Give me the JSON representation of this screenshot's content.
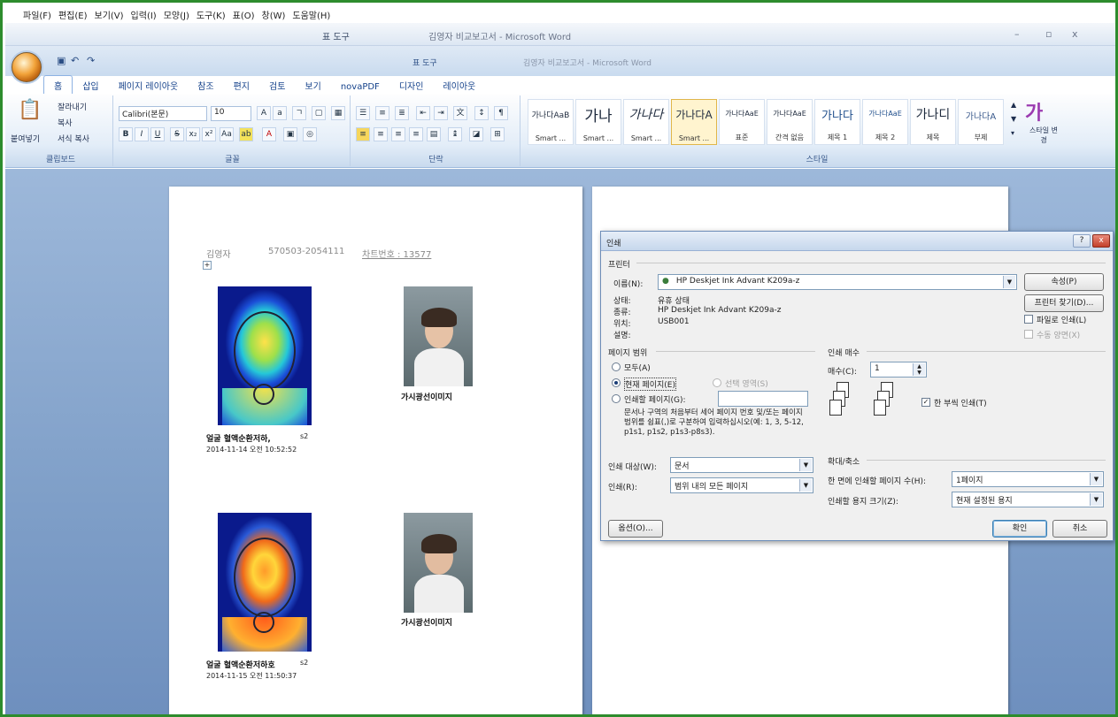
{
  "menu": [
    "파일(F)",
    "편집(E)",
    "보기(V)",
    "입력(I)",
    "모양(J)",
    "도구(K)",
    "표(O)",
    "창(W)",
    "도움말(H)"
  ],
  "window": {
    "context_tools": "표 도구",
    "doc_title": "김영자 비교보고서 - Microsoft Word"
  },
  "ribbon": {
    "tabs": [
      "홈",
      "삽입",
      "페이지 레이아웃",
      "참조",
      "편지",
      "검토",
      "보기",
      "novaPDF",
      "디자인",
      "레이아웃"
    ],
    "context_label": "표 도구",
    "clipboard": {
      "paste": "붙여넣기",
      "cut": "잘라내기",
      "copy": "복사",
      "format_painter": "서식 복사",
      "label": "클립보드"
    },
    "font": {
      "name": "Calibri(본문)",
      "size": "10",
      "label": "글꼴"
    },
    "paragraph_label": "단락",
    "styles": [
      {
        "preview": "가나다AaB",
        "name": "Smart ..."
      },
      {
        "preview": "가나",
        "name": "Smart ..."
      },
      {
        "preview": "가나다",
        "name": "Smart ..."
      },
      {
        "preview": "가나다A",
        "name": "Smart ..."
      },
      {
        "preview": "가나다AaE",
        "name": "표준"
      },
      {
        "preview": "가나다AaE",
        "name": "간격 없음"
      },
      {
        "preview": "가나다",
        "name": "제목 1"
      },
      {
        "preview": "가나다AaE",
        "name": "제목 2"
      },
      {
        "preview": "가나디",
        "name": "제목"
      },
      {
        "preview": "가나다A",
        "name": "부제"
      }
    ],
    "style_change": "스타일 변경",
    "styles_label": "스타일"
  },
  "document": {
    "header_name": "김영자",
    "header_id": "570503-2054111",
    "header_chart": "차트번호 : 13577",
    "caption_1": "얼굴 혈액순환저하,",
    "caption_1_suffix": "s2",
    "date_1": "2014-11-14 오전 10:52:52",
    "caption_2": "얼굴 혈액순환저하호",
    "caption_2_suffix": "s2",
    "date_2": "2014-11-15 오전 11:50:37",
    "photo_caption_1": "가시광선이미지",
    "photo_caption_2": "가시광선이미지"
  },
  "print_dialog": {
    "title": "인쇄",
    "printer_section": "프린터",
    "name_label": "이름(N):",
    "printer_name": "HP Deskjet Ink Advant K209a-z",
    "status_label": "상태:",
    "status_value": "유휴 상태",
    "type_label": "종류:",
    "type_value": "HP Deskjet Ink Advant K209a-z",
    "where_label": "위치:",
    "where_value": "USB001",
    "comment_label": "설명:",
    "properties_button": "속성(P)",
    "find_printer_button": "프린터 찾기(D)...",
    "print_to_file": "파일로 인쇄(L)",
    "manual_duplex": "수동 양면(X)",
    "page_range_section": "페이지 범위",
    "all_option": "모두(A)",
    "current_page_option": "현재 페이지(E)",
    "selection_option": "선택 영역(S)",
    "pages_option": "인쇄할 페이지(G):",
    "pages_help": "문서나 구역의 처음부터 세어 페이지 번호 및/또는 페이지 범위를 쉼표(,)로 구분하여 입력하십시오(예: 1, 3, 5-12, p1s1, p1s2, p1s3-p8s3).",
    "copies_section": "인쇄 매수",
    "copies_label": "매수(C):",
    "copies_value": "1",
    "collate_label": "한 부씩 인쇄(T)",
    "print_what_label": "인쇄 대상(W):",
    "print_what_value": "문서",
    "print_label": "인쇄(R):",
    "print_value": "범위 내의 모든 페이지",
    "zoom_section": "확대/축소",
    "pages_per_sheet_label": "한 면에 인쇄할 페이지 수(H):",
    "pages_per_sheet_value": "1페이지",
    "scale_label": "인쇄할 용지 크기(Z):",
    "scale_value": "현재 설정된 용지",
    "options_button": "옵션(O)...",
    "ok_button": "확인",
    "cancel_button": "취소"
  }
}
